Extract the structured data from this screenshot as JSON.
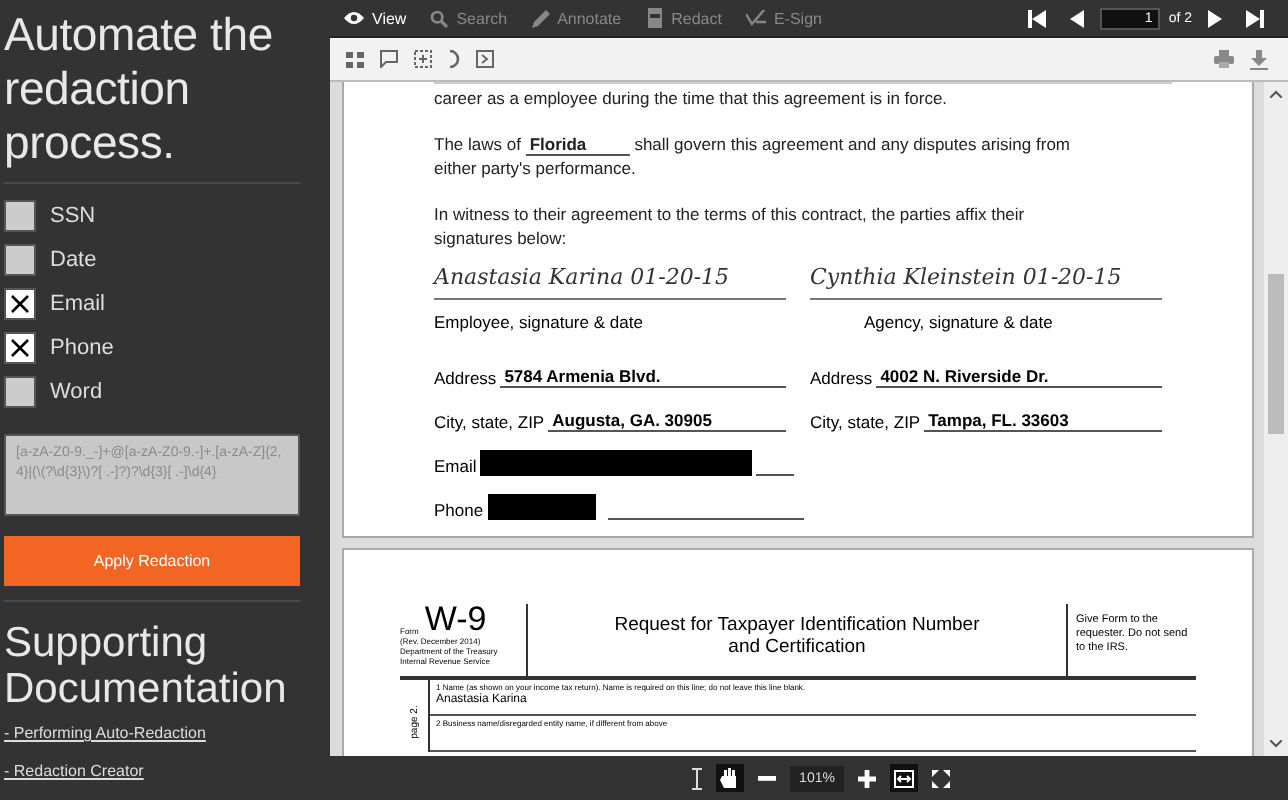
{
  "sidebar": {
    "heading": "Automate the redaction process.",
    "options": [
      {
        "label": "SSN",
        "checked": false
      },
      {
        "label": "Date",
        "checked": false
      },
      {
        "label": "Email",
        "checked": true
      },
      {
        "label": "Phone",
        "checked": true
      },
      {
        "label": "Word",
        "checked": false
      }
    ],
    "pattern": "[a-zA-Z0-9._-]+@[a-zA-Z0-9.-]+.[a-zA-Z]{2,4}|(\\(?\\d{3}\\)?[ .-]?)?\\d{3}[ .-]\\d{4}",
    "apply_button": "Apply Redaction",
    "docs_heading": "Supporting Documentation",
    "links": [
      "- Performing Auto-Redaction",
      "- Redaction Creator"
    ]
  },
  "viewer": {
    "tabs": [
      {
        "label": "View",
        "kind": "eye",
        "selected": true
      },
      {
        "label": "Search",
        "kind": "search",
        "selected": false
      },
      {
        "label": "Annotate",
        "kind": "pen",
        "selected": false
      },
      {
        "label": "Redact",
        "kind": "redact",
        "selected": false
      },
      {
        "label": "E-Sign",
        "kind": "sign",
        "selected": false
      }
    ],
    "page_input": "1",
    "page_total": "of 2",
    "zoom": "101%"
  },
  "page_1": {
    "intro": "career as a employee during the time that this agreement is in force.",
    "laws_before": "The laws of",
    "laws_value": "Florida",
    "laws_after": "shall govern this agreement and any disputes arising from either party's performance.",
    "witness": "In witness to their agreement to the terms of this contract, the parties affix their signatures below:",
    "parties": [
      {
        "signature": "Anastasia Karina  01-20-15",
        "role": "Employee, signature & date",
        "address_label": "Address",
        "address": "5784 Armenia Blvd.",
        "city_label": "City, state, ZIP",
        "city": "Augusta, GA. 30905"
      },
      {
        "signature": "Cynthia Kleinstein 01-20-15",
        "role": "Agency, signature & date",
        "address_label": "Address",
        "address": "4002 N. Riverside Dr.",
        "city_label": "City, state, ZIP",
        "city": "Tampa, FL. 33603"
      }
    ],
    "email_label": "Email",
    "phone_label": "Phone"
  },
  "page_2": {
    "form_label": "Form",
    "form_number": "W-9",
    "revision": "(Rev. December 2014)",
    "department": "Department of the Treasury Internal Revenue Service",
    "title": "Request for Taxpayer Identification Number and Certification",
    "instruction": "Give Form to the requester. Do not send to the IRS.",
    "side_note": "page 2.",
    "line_1_label": "1  Name (as shown on your income tax return). Name is required on this line; do not leave this line blank.",
    "line_1_value": "Anastasia Karina",
    "line_2_label": "2  Business name/disregarded entity name, if different from above"
  }
}
